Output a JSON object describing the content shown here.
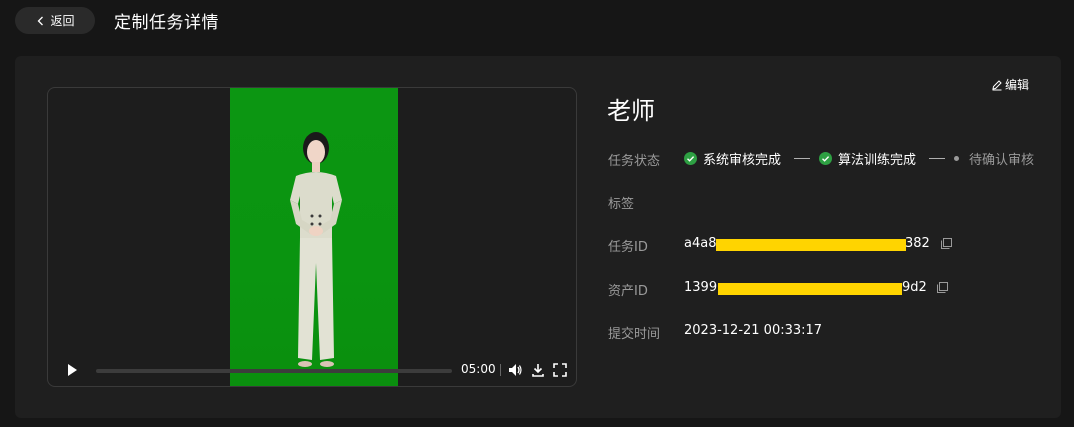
{
  "header": {
    "back_label": "返回",
    "title": "定制任务详情"
  },
  "player": {
    "time": "05:00",
    "progress": 0
  },
  "detail": {
    "edit_label": "编辑",
    "name": "老师",
    "status_label": "任务状态",
    "steps": [
      {
        "label": "系统审核完成",
        "state": "done"
      },
      {
        "label": "算法训练完成",
        "state": "done"
      },
      {
        "label": "待确认审核",
        "state": "pending"
      }
    ],
    "tag_label": "标签",
    "task_id_label": "任务ID",
    "task_id_prefix": "a4a8",
    "task_id_suffix": "382",
    "asset_id_label": "资产ID",
    "asset_id_prefix": "1399",
    "asset_id_suffix": "9d2",
    "submit_time_label": "提交时间",
    "submit_time": "2023-12-21 00:33:17"
  },
  "colors": {
    "success": "#2ea043",
    "redaction": "#ffd400",
    "chroma_green": "#0c9612"
  }
}
